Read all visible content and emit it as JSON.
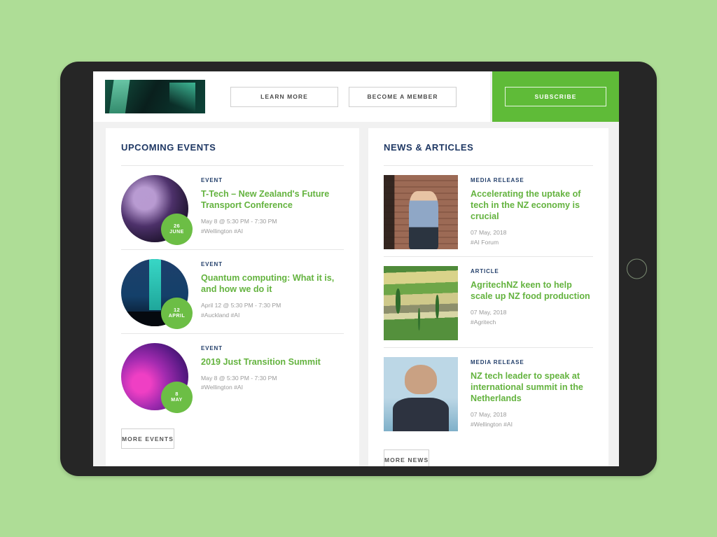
{
  "device": {
    "home_button": "home-button"
  },
  "banner": {
    "thumb_alt": "conference-photo",
    "learn_more_label": "LEARN MORE",
    "become_member_label": "BECOME A MEMBER",
    "subscribe_label": "SUBSCRIBE",
    "subscribe_panel_color": "#5fbb38"
  },
  "events": {
    "title": "UPCOMING EVENTS",
    "more_label": "MORE EVENTS",
    "items": [
      {
        "kicker": "EVENT",
        "title": "T-Tech – New Zealand's Future Transport Conference",
        "datetime": "May 8 @ 5:30 PM - 7:30 PM",
        "tags": "#Wellington #AI",
        "badge_day": "26",
        "badge_month": "JUNE"
      },
      {
        "kicker": "EVENT",
        "title": "Quantum computing: What it is, and how we do it",
        "datetime": "April 12 @ 5:30 PM - 7:30 PM",
        "tags": "#Auckland #AI",
        "badge_day": "12",
        "badge_month": "APRIL"
      },
      {
        "kicker": "EVENT",
        "title": "2019 Just Transition Summit",
        "datetime": "May 8 @ 5:30 PM - 7:30 PM",
        "tags": "#Wellington #AI",
        "badge_day": "8",
        "badge_month": "MAY"
      }
    ]
  },
  "news": {
    "title": "NEWS & ARTICLES",
    "more_label": "MORE NEWS",
    "items": [
      {
        "kicker": "MEDIA RELEASE",
        "title": "Accelerating the uptake of tech in the NZ economy is crucial",
        "date": "07 May, 2018",
        "tags": "#AI Forum"
      },
      {
        "kicker": "ARTICLE",
        "title": "AgritechNZ keen to help scale up NZ food production",
        "date": "07 May, 2018",
        "tags": "#Agritech"
      },
      {
        "kicker": "MEDIA RELEASE",
        "title": "NZ tech leader to speak at international summit in the Netherlands",
        "date": "07 May, 2018",
        "tags": "#Wellington #AI"
      }
    ]
  },
  "colors": {
    "page_background": "#aedd96",
    "device_frame": "#262626",
    "screen_background": "#f1f1f1",
    "accent_green": "#64b33f",
    "heading_navy": "#1f3864",
    "badge_green": "#6cbe45"
  }
}
